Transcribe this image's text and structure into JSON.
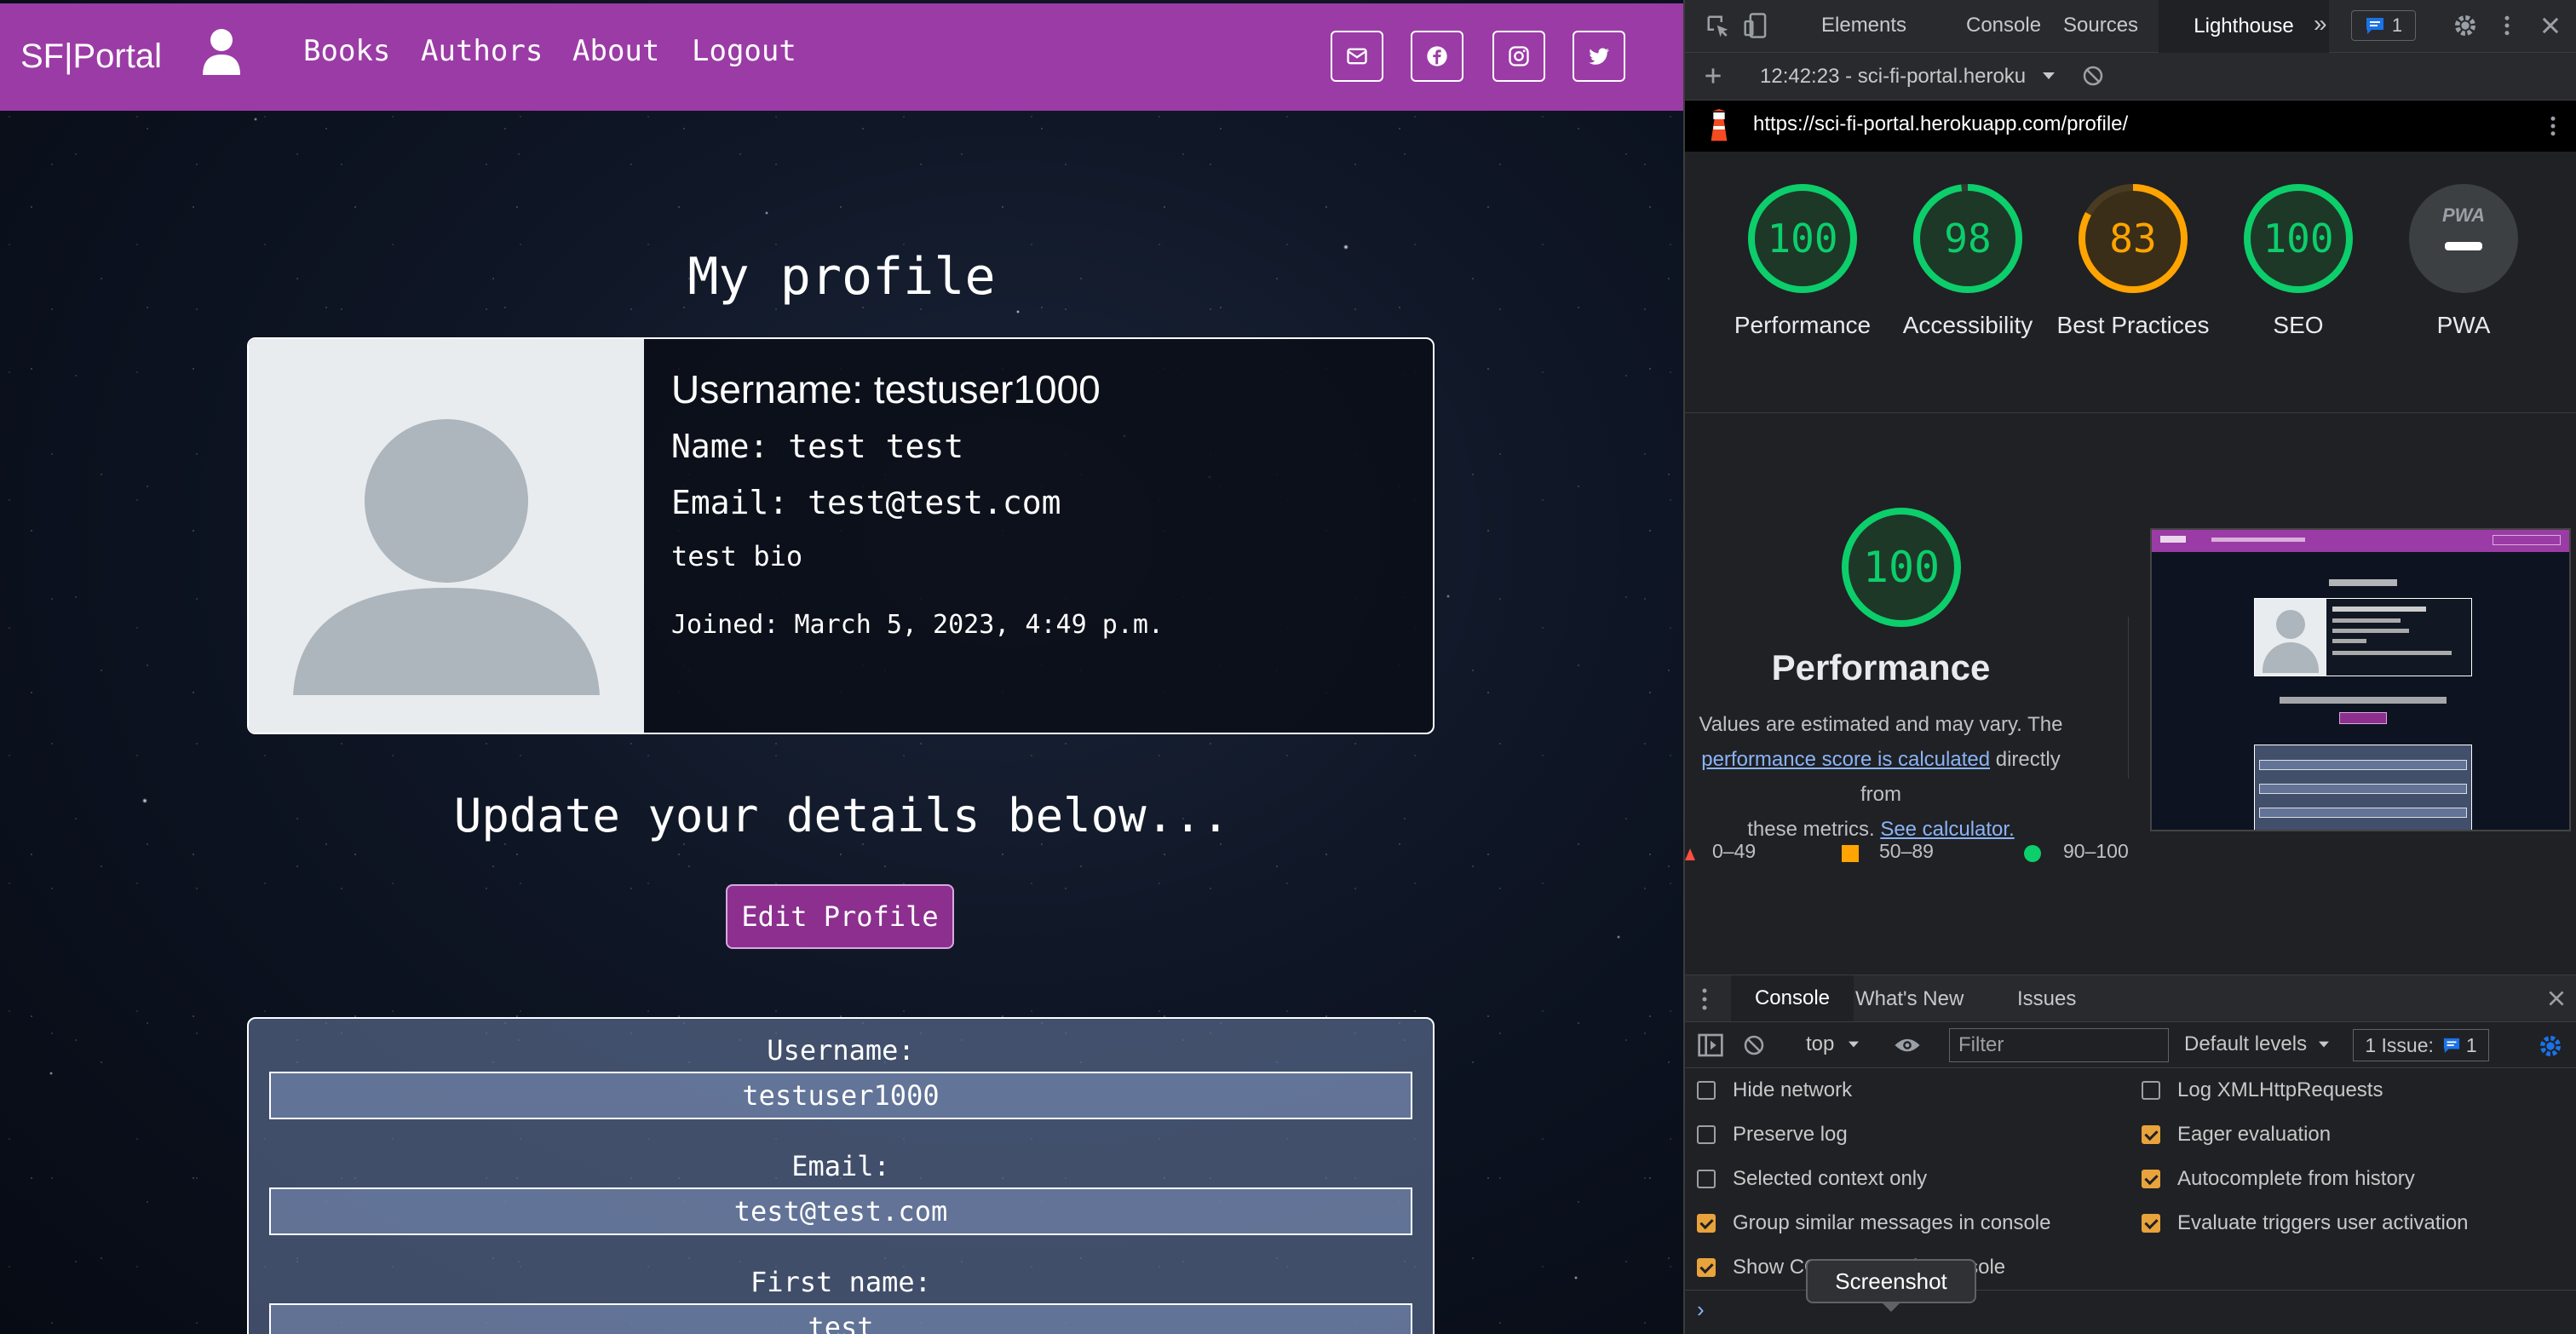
{
  "site": {
    "brand": "SF|Portal",
    "nav": {
      "books": "Books",
      "authors": "Authors",
      "about": "About",
      "logout": "Logout"
    },
    "title": "My profile",
    "profile": {
      "username": "Username: testuser1000",
      "name": "Name: test test",
      "email": "Email: test@test.com",
      "bio": "test bio",
      "joined": "Joined: March 5, 2023, 4:49 p.m."
    },
    "update_heading": "Update your details below...",
    "edit_button": "Edit Profile",
    "form": {
      "username_label": "Username:",
      "username_value": "testuser1000",
      "email_label": "Email:",
      "email_value": "test@test.com",
      "first_name_label": "First name:",
      "first_name_value": "test"
    }
  },
  "devtools": {
    "tabs": {
      "elements": "Elements",
      "console": "Console",
      "sources": "Sources",
      "lighthouse": "Lighthouse",
      "more": "»",
      "issues_count": "1"
    },
    "report_select": "12:42:23 - sci-fi-portal.heroku",
    "url": "https://sci-fi-portal.herokuapp.com/profile/",
    "scores": [
      {
        "label": "Performance",
        "value": "100",
        "color": "#0cce6b"
      },
      {
        "label": "Accessibility",
        "value": "98",
        "color": "#0cce6b"
      },
      {
        "label": "Best Practices",
        "value": "83",
        "color": "#ffa400"
      },
      {
        "label": "SEO",
        "value": "100",
        "color": "#0cce6b"
      },
      {
        "label": "PWA",
        "value": "PWA",
        "color": "#9aa0a6"
      }
    ],
    "performance": {
      "score": "100",
      "title": "Performance",
      "desc_1": "Values are estimated and may vary. The",
      "link_1": "performance score is calculated",
      "desc_2": "directly from",
      "desc_3": "these metrics.",
      "link_2": "See calculator."
    },
    "legend": {
      "fail": "0–49",
      "average": "50–89",
      "pass": "90–100"
    },
    "drawer": {
      "tabs": {
        "console": "Console",
        "whats_new": "What's New",
        "issues": "Issues"
      },
      "context": "top",
      "filter_placeholder": "Filter",
      "levels": "Default levels",
      "issues_badge": "1 Issue:",
      "issues_count": "1"
    },
    "settings": {
      "hide_network": "Hide network",
      "preserve_log": "Preserve log",
      "selected_context": "Selected context only",
      "group_similar": "Group similar messages in console",
      "show_cors": "Show CORS errors in console",
      "log_xhr": "Log XMLHttpRequests",
      "eager_eval": "Eager evaluation",
      "autocomplete": "Autocomplete from history",
      "eval_triggers": "Evaluate triggers user activation"
    },
    "tooltip": "Screenshot",
    "prompt": "›"
  },
  "colors": {
    "navbar": "#9b3ba6",
    "pass": "#0cce6b",
    "average": "#ffa400",
    "fail": "#ff4e42",
    "link": "#8ab4f8"
  }
}
